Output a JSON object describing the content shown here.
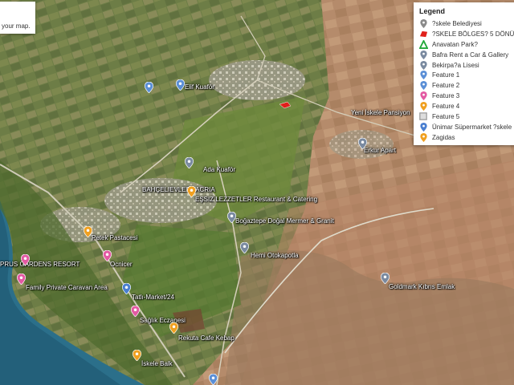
{
  "hint": {
    "text": "your map."
  },
  "legend": {
    "title": "Legend",
    "items": [
      {
        "label": "?skele Belediyesi",
        "icon": "pin-icon",
        "color": "#8a8a8a"
      },
      {
        "label": "?SKELE BÖLGES? 5 DÖNÜM",
        "icon": "area-icon",
        "color": "#e0201b"
      },
      {
        "label": "Anavatan Park?",
        "icon": "triangle-icon",
        "color": "#22a83a"
      },
      {
        "label": "Bafra Rent a Car & Gallery",
        "icon": "pin-icon",
        "color": "#7a8aa0"
      },
      {
        "label": "Bekirpa?a Lisesi",
        "icon": "pin-icon",
        "color": "#7a8aa0"
      },
      {
        "label": "Feature 1",
        "icon": "pin-icon",
        "color": "#5b8fd6"
      },
      {
        "label": "Feature 2",
        "icon": "pin-icon",
        "color": "#5b8fd6"
      },
      {
        "label": "Feature 3",
        "icon": "pin-icon",
        "color": "#e35aa3"
      },
      {
        "label": "Feature 4",
        "icon": "pin-icon",
        "color": "#f0a020"
      },
      {
        "label": "Feature 5",
        "icon": "square-icon",
        "color": "#9a9a9a"
      },
      {
        "label": "Ünimar Süpermarket ?skele",
        "icon": "pin-icon",
        "color": "#4a7fd0"
      },
      {
        "label": "Zagidas",
        "icon": "pin-icon",
        "color": "#f0a020"
      }
    ]
  },
  "labels": {
    "bahcelievler": "BAHÇELIEVLER",
    "gacria": "GACRIA",
    "essiz": "EŞSIZ LEZZETLER Restaurant & Catering",
    "bogaztepe": "Boğaztepe Doğal Mermer & Granit",
    "petek": "Petek Pastacesi",
    "gardens": "PRUS GARDENS RESORT",
    "ocnicer": "Ocnicer",
    "caravan": "Family Private Caravan Area",
    "tatli": "Tatlı-Market/24",
    "saglik": "Sağlık Eczanesi",
    "rekuta": "Rekuta Cafe Kebap",
    "iskeleball": "İskele Balk",
    "goldmark": "Goldmark Kıbrıs Emlak",
    "yeni": "Yeni İskele Pansiyon",
    "erkur": "Erkur Apart",
    "kuafor": "Elif Kuaför",
    "ada": "Ada Kuaför",
    "hemi": "Hemi Otokapotla"
  }
}
